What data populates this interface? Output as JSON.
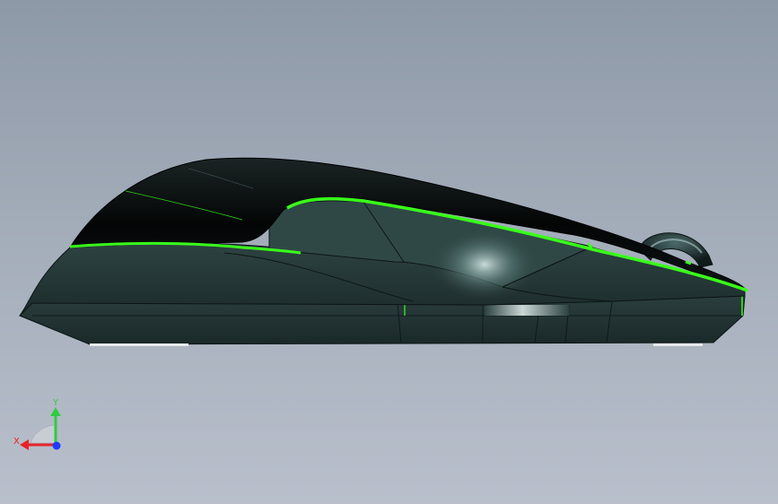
{
  "view": {
    "background_top": "#8e99a8",
    "background_bottom": "#b9c0cc",
    "model": "computer-mouse-side-view"
  },
  "triad": {
    "y_label": "Y",
    "x_label": "X",
    "y_color": "#2ecc40",
    "x_color": "#e8232a",
    "z_color": "#1e3cff"
  },
  "colors": {
    "shell_dark": "#070909",
    "body": "#233434",
    "accent": "#39ff1a",
    "wheel": "#1a2a2a"
  }
}
